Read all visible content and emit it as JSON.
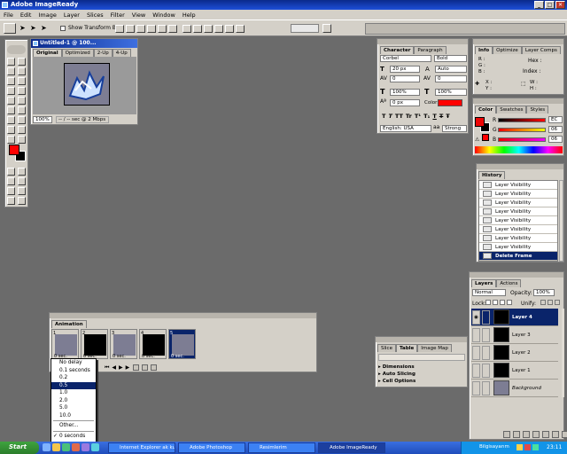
{
  "app": {
    "title": "Adobe ImageReady"
  },
  "menu": [
    "File",
    "Edit",
    "Image",
    "Layer",
    "Slices",
    "Filter",
    "View",
    "Window",
    "Help"
  ],
  "options": {
    "show_transform_box": "Show Transform Box"
  },
  "doc": {
    "title": "Untitled-1 @ 100...",
    "tabs": [
      "Original",
      "Optimized",
      "2-Up",
      "4-Up"
    ],
    "zoom": "100%",
    "status": "-- / -- sec @ 2 Mbps"
  },
  "character": {
    "tabs": [
      "Character",
      "Paragraph"
    ],
    "font": "Corbel",
    "style": "Bold",
    "size": "20 px",
    "leading": "Auto",
    "kerning": "0",
    "tracking": "0",
    "vscale": "100%",
    "hscale": "100%",
    "baseline": "0 px",
    "color_label": "Color:",
    "glyphs": [
      "T",
      "T",
      "TT",
      "Tr",
      "T¹",
      "T₁",
      "T",
      "T",
      "Ŧ"
    ],
    "language": "English: USA",
    "antialias": "Strong",
    "color": "#ff0000"
  },
  "info": {
    "tabs": [
      "Info",
      "Optimize",
      "Layer Comps"
    ],
    "hex": "Hex :",
    "index": "Index :",
    "xy": [
      "X :",
      "Y :"
    ],
    "wh": [
      "W :",
      "H :"
    ],
    "rgb": [
      "R :",
      "G :",
      "B :"
    ]
  },
  "color": {
    "tabs": [
      "Color",
      "Swatches",
      "Styles"
    ],
    "channels": [
      {
        "name": "R",
        "value": "EC"
      },
      {
        "name": "G",
        "value": "06"
      },
      {
        "name": "B",
        "value": "06"
      }
    ],
    "fg": "#ec0606"
  },
  "history": {
    "title": "History",
    "items": [
      "Layer Visibility",
      "Layer Visibility",
      "Layer Visibility",
      "Layer Visibility",
      "Layer Visibility",
      "Layer Visibility",
      "Layer Visibility",
      "Layer Visibility"
    ],
    "selected": "Delete Frame"
  },
  "layers": {
    "tabs": [
      "Layers",
      "Actions"
    ],
    "blend": "Normal",
    "opacity_label": "Opacity:",
    "opacity": "100%",
    "lock": "Lock:",
    "unify": "Unify:",
    "items": [
      {
        "name": "Layer 4",
        "selected": true,
        "italic": false
      },
      {
        "name": "Layer 3",
        "selected": false,
        "italic": false
      },
      {
        "name": "Layer 2",
        "selected": false,
        "italic": false
      },
      {
        "name": "Layer 1",
        "selected": false,
        "italic": false
      },
      {
        "name": "Background",
        "selected": false,
        "italic": true
      }
    ]
  },
  "slice": {
    "tabs": [
      "Slice",
      "Table",
      "Image Map"
    ],
    "sections": [
      "Dimensions",
      "Auto Slicing",
      "Cell Options"
    ]
  },
  "animation": {
    "title": "Animation",
    "frames": [
      {
        "num": "1",
        "delay": "0 sec."
      },
      {
        "num": "2",
        "delay": "0 sec."
      },
      {
        "num": "3",
        "delay": "0 sec."
      },
      {
        "num": "4",
        "delay": "0 sec."
      },
      {
        "num": "5",
        "delay": "0 sec."
      }
    ]
  },
  "delay_menu": {
    "items": [
      "No delay",
      "0.1 seconds",
      "0.2",
      "0.5",
      "1.0",
      "2.0",
      "5.0",
      "10.0",
      "Other...",
      "0 seconds"
    ],
    "selected": "0.5",
    "checked": "0 seconds"
  },
  "taskbar": {
    "start": "Start",
    "tasks": [
      "Internet Explorer ak kull...",
      "Adobe Photoshop",
      "Resimlerim",
      "Adobe ImageReady"
    ],
    "tray": "Bilgisayarım",
    "clock": "23:11"
  }
}
